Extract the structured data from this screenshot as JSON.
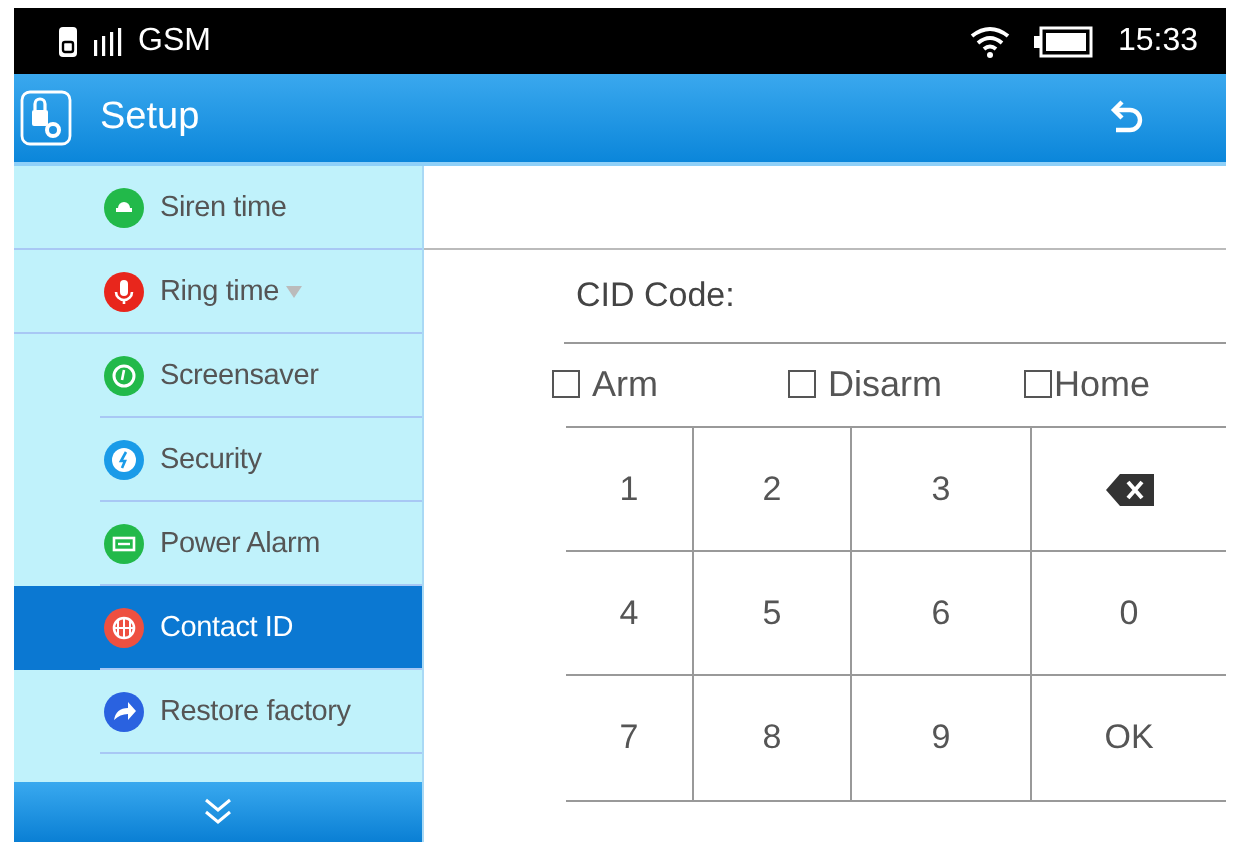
{
  "status_bar": {
    "network": "GSM",
    "time": "15:33"
  },
  "header": {
    "title": "Setup"
  },
  "sidebar": {
    "items": [
      {
        "label": "Siren time",
        "color": "#22b94a",
        "dropdown": false,
        "selected": false
      },
      {
        "label": "Ring time",
        "color": "#e8261c",
        "dropdown": true,
        "selected": false
      },
      {
        "label": "Screensaver",
        "color": "#22b94a",
        "dropdown": false,
        "selected": false
      },
      {
        "label": "Security",
        "color": "#1a9be8",
        "dropdown": false,
        "selected": false
      },
      {
        "label": "Power Alarm",
        "color": "#22b94a",
        "dropdown": false,
        "selected": false
      },
      {
        "label": "Contact ID",
        "color": "#ee5040",
        "dropdown": false,
        "selected": true
      },
      {
        "label": "Restore factory",
        "color": "#2a62e0",
        "dropdown": false,
        "selected": false
      }
    ]
  },
  "content": {
    "cid_label": "CID Code:",
    "options": [
      {
        "label": "Arm",
        "checked": false
      },
      {
        "label": "Disarm",
        "checked": false
      },
      {
        "label": "Home",
        "checked": false
      }
    ],
    "keys": [
      {
        "kind": "text",
        "label": "1"
      },
      {
        "kind": "text",
        "label": "2"
      },
      {
        "kind": "text",
        "label": "3"
      },
      {
        "kind": "backspace"
      },
      {
        "kind": "text",
        "label": "4"
      },
      {
        "kind": "text",
        "label": "5"
      },
      {
        "kind": "text",
        "label": "6"
      },
      {
        "kind": "text",
        "label": "0"
      },
      {
        "kind": "text",
        "label": "7"
      },
      {
        "kind": "text",
        "label": "8"
      },
      {
        "kind": "text",
        "label": "9"
      },
      {
        "kind": "text",
        "label": "OK"
      }
    ]
  }
}
